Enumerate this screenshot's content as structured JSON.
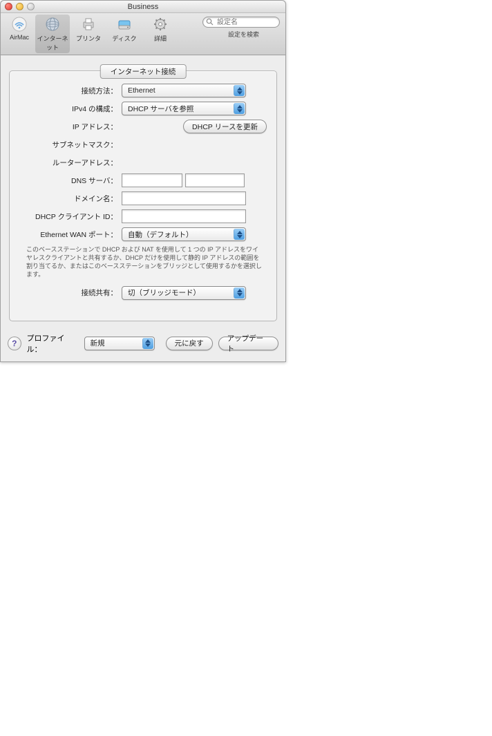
{
  "window": {
    "title": "Business"
  },
  "toolbar": {
    "items": [
      {
        "label": "AirMac",
        "icon": "wifi-icon"
      },
      {
        "label": "インターネット",
        "icon": "globe-icon"
      },
      {
        "label": "プリンタ",
        "icon": "printer-icon"
      },
      {
        "label": "ディスク",
        "icon": "disk-icon"
      },
      {
        "label": "詳細",
        "icon": "gear-icon"
      }
    ],
    "search_placeholder": "設定名",
    "search_help": "設定を検索"
  },
  "tab": {
    "title": "インターネット接続"
  },
  "form": {
    "connect_method": {
      "label": "接続方法：",
      "value": "Ethernet"
    },
    "ipv4_config": {
      "label": "IPv4 の構成：",
      "value": "DHCP サーバを参照"
    },
    "ip_address": {
      "label": "IP アドレス：",
      "button": "DHCP リースを更新"
    },
    "subnet_mask": {
      "label": "サブネットマスク："
    },
    "router_address": {
      "label": "ルーターアドレス："
    },
    "dns_server": {
      "label": "DNS サーバ：",
      "value1": "",
      "value2": ""
    },
    "domain_name": {
      "label": "ドメイン名：",
      "value": ""
    },
    "dhcp_client_id": {
      "label": "DHCP クライアント ID：",
      "value": ""
    },
    "wan_port": {
      "label": "Ethernet WAN ポート：",
      "value": "自動（デフォルト）"
    },
    "hint": "このベースステーションで DHCP および NAT を使用して 1 つの IP アドレスをワイヤレスクライアントと共有するか、DHCP だけを使用して静的 IP アドレスの範囲を割り当てるか、またはこのベースステーションをブリッジとして使用するかを選択します。",
    "connection_sharing": {
      "label": "接続共有：",
      "value": "切（ブリッジモード）"
    }
  },
  "footer": {
    "profile_label": "プロファイル：",
    "profile_value": "新規",
    "revert": "元に戻す",
    "update": "アップデート"
  }
}
